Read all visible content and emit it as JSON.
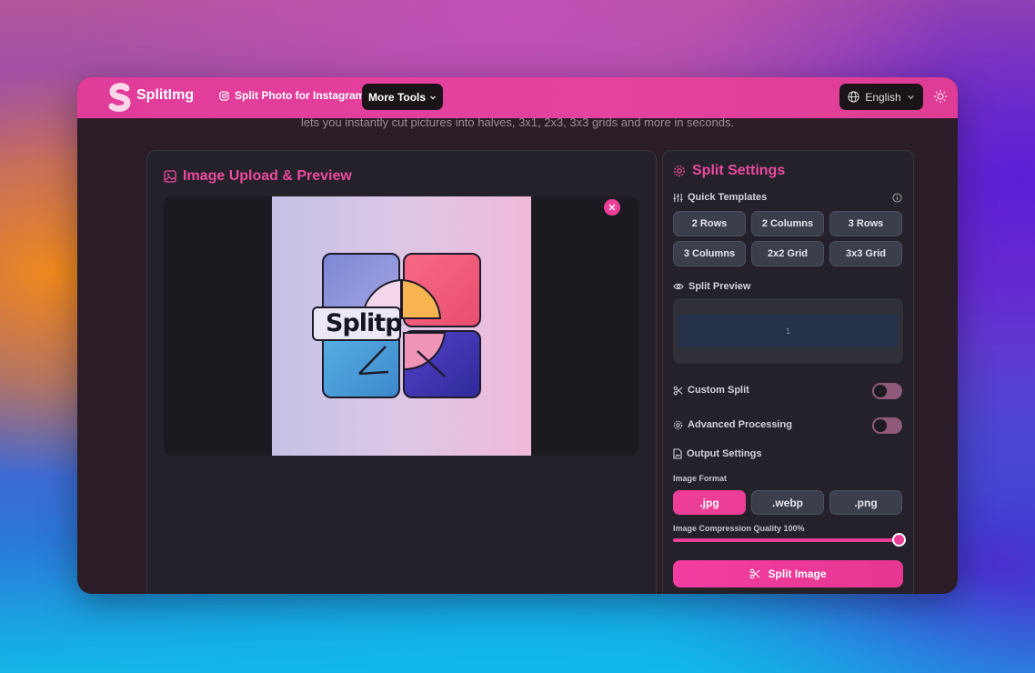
{
  "navbar": {
    "brand": "SplitImg",
    "nav_link": "Split Photo for Instagram",
    "more_tools": "More Tools",
    "language": "English"
  },
  "hero": {
    "subtitle": "lets you instantly cut pictures into halves, 3x1, 2x3, 3x3 grids and more in seconds."
  },
  "upload": {
    "title": "Image Upload & Preview",
    "image_text": "Splitp"
  },
  "settings": {
    "title": "Split Settings",
    "quick_templates": "Quick Templates",
    "templates": [
      "2 Rows",
      "2 Columns",
      "3 Rows",
      "3 Columns",
      "2x2 Grid",
      "3x3 Grid"
    ],
    "split_preview": "Split Preview",
    "preview_cell": "1",
    "custom_split": "Custom Split",
    "custom_split_on": false,
    "advanced_processing": "Advanced Processing",
    "advanced_processing_on": false,
    "output_settings": "Output Settings",
    "image_format_label": "Image Format",
    "formats": [
      ".jpg",
      ".webp",
      ".png"
    ],
    "selected_format": ".jpg",
    "quality_label": "Image Compression Quality 100%",
    "quality_value": 100,
    "split_button": "Split Image"
  },
  "colors": {
    "accent": "#ec3e97",
    "navbar": "#e23c9a",
    "panel": "#24212b"
  }
}
